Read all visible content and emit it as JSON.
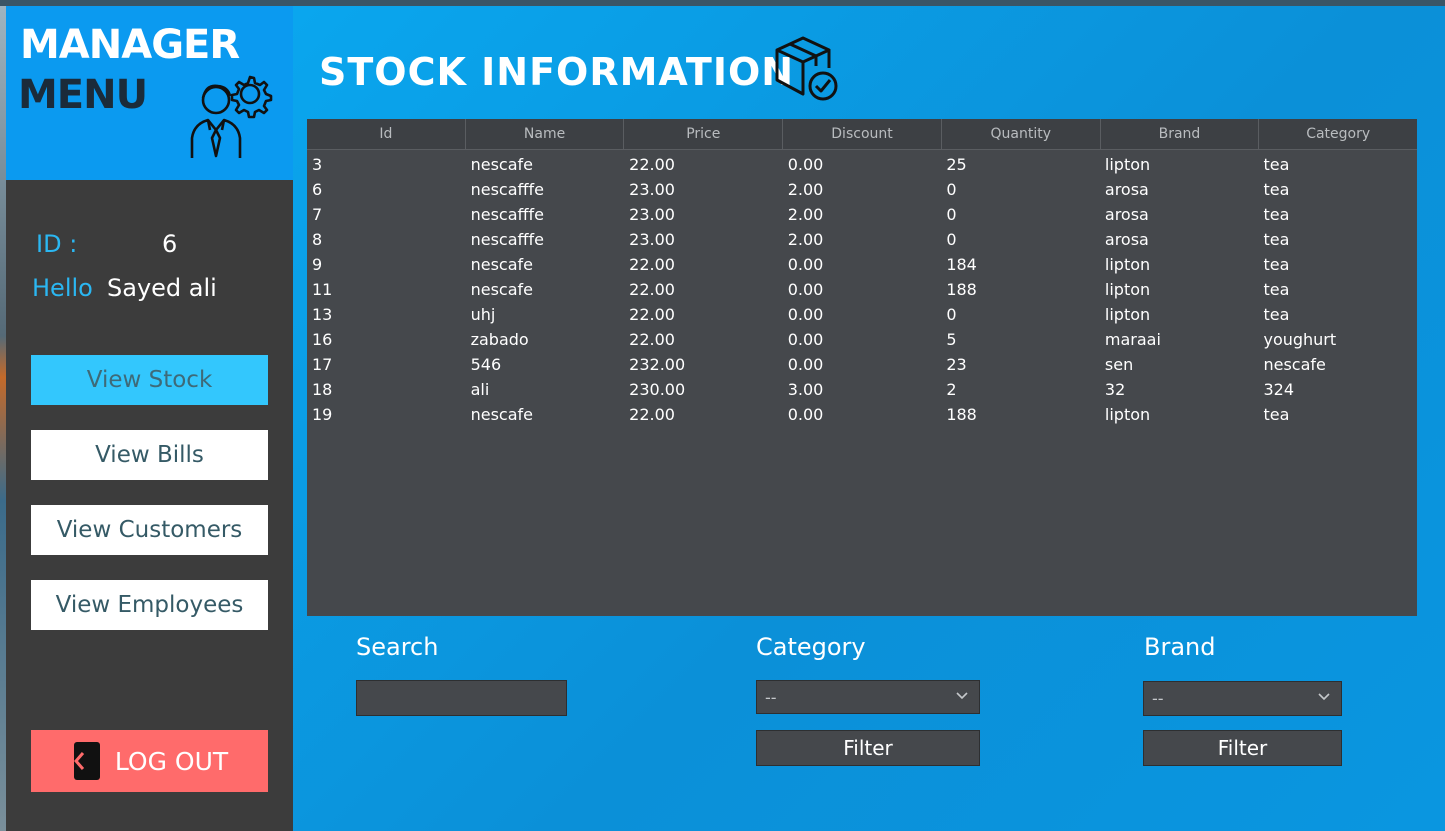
{
  "sidebar": {
    "brand_line1": "MANAGER",
    "brand_line2": "MENU",
    "id_label": "ID :",
    "id_value": "6",
    "hello_label": "Hello",
    "user_name": "Sayed ali",
    "nav": {
      "view_stock": "View Stock",
      "view_bills": "View Bills",
      "view_customers": "View Customers",
      "view_employees": "View Employees"
    },
    "logout_label": "LOG OUT"
  },
  "main": {
    "title": "STOCK INFORMATION",
    "table": {
      "columns": [
        "Id",
        "Name",
        "Price",
        "Discount",
        "Quantity",
        "Brand",
        "Category"
      ],
      "rows": [
        [
          "3",
          "nescafe",
          "22.00",
          "0.00",
          "25",
          "lipton",
          "tea"
        ],
        [
          "6",
          "nescafffe",
          "23.00",
          "2.00",
          "0",
          "arosa",
          "tea"
        ],
        [
          "7",
          "nescafffe",
          "23.00",
          "2.00",
          "0",
          "arosa",
          "tea"
        ],
        [
          "8",
          "nescafffe",
          "23.00",
          "2.00",
          "0",
          "arosa",
          "tea"
        ],
        [
          "9",
          "nescafe",
          "22.00",
          "0.00",
          "184",
          "lipton",
          "tea"
        ],
        [
          "11",
          "nescafe",
          "22.00",
          "0.00",
          "188",
          "lipton",
          "tea"
        ],
        [
          "13",
          "uhj",
          "22.00",
          "0.00",
          "0",
          "lipton",
          "tea"
        ],
        [
          "16",
          "zabado",
          "22.00",
          "0.00",
          "5",
          "maraai",
          "youghurt"
        ],
        [
          "17",
          "546",
          "232.00",
          "0.00",
          "23",
          "sen",
          "nescafe"
        ],
        [
          "18",
          "ali",
          "230.00",
          "3.00",
          "2",
          "32",
          "324"
        ],
        [
          "19",
          "nescafe",
          "22.00",
          "0.00",
          "188",
          "lipton",
          "tea"
        ]
      ]
    },
    "search": {
      "label": "Search",
      "value": ""
    },
    "category": {
      "label": "Category",
      "selected": "--",
      "filter_label": "Filter"
    },
    "brand": {
      "label": "Brand",
      "selected": "--",
      "filter_label": "Filter"
    }
  },
  "colors": {
    "sidebar_bg": "#3c3c3c",
    "brand_blue": "#0b9af0",
    "accent_cyan": "#33c7fd",
    "logout_red": "#ff6b6b",
    "grid_bg": "#45484c"
  }
}
